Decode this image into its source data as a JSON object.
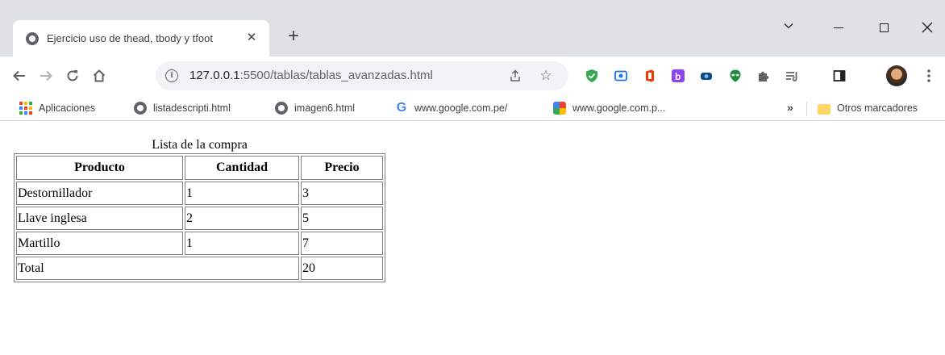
{
  "browser": {
    "tab_title": "Ejercicio uso de thead, tbody y tfoot",
    "new_tab_label": "+",
    "url_host": "127.0.0.1",
    "url_rest": ":5500/tablas/tablas_avanzadas.html"
  },
  "bookmarks": [
    {
      "label": "Aplicaciones",
      "icon": "apps-icon"
    },
    {
      "label": "listadescripti.html",
      "icon": "globe-icon"
    },
    {
      "label": "imagen6.html",
      "icon": "globe-icon"
    },
    {
      "label": "www.google.com.pe/",
      "icon": "google-icon"
    },
    {
      "label": "www.google.com.p...",
      "icon": "puzzle-icon"
    }
  ],
  "other_bookmarks": "Otros marcadores",
  "table": {
    "caption": "Lista de la compra",
    "headers": [
      "Producto",
      "Cantidad",
      "Precio"
    ],
    "rows": [
      [
        "Destornillador",
        "1",
        "3"
      ],
      [
        "Llave inglesa",
        "2",
        "5"
      ],
      [
        "Martillo",
        "1",
        "7"
      ]
    ],
    "footer": {
      "label": "Total",
      "value": "20"
    }
  }
}
